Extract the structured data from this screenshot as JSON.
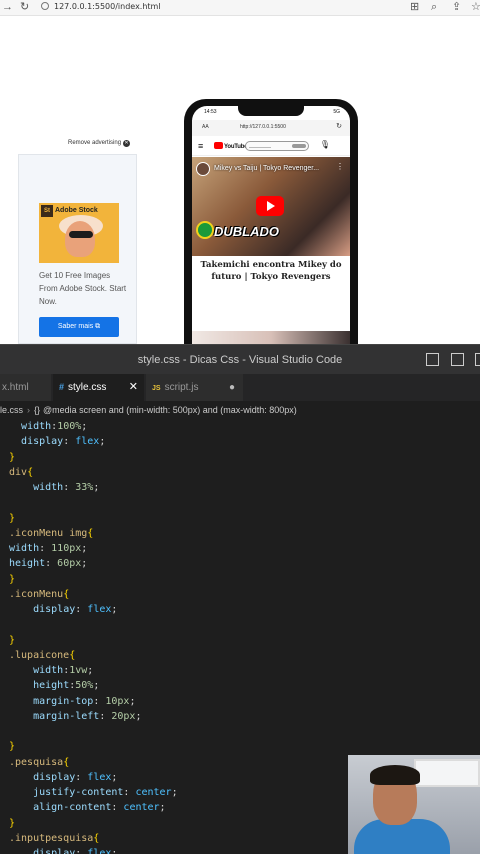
{
  "browser": {
    "url": "127.0.0.1:5500/index.html"
  },
  "page": {
    "ad": {
      "remove_label": "Remove advertising",
      "brand": "Adobe Stock",
      "brand_badge": "St",
      "text": "Get 10 Free Images From Adobe Stock. Start Now.",
      "button_label": "Saber mais"
    },
    "phone": {
      "time": "14:53",
      "status": "5G",
      "aa": "AA",
      "url": "http://127.0.0.1:5500",
      "yt_logo": "YouTube",
      "video_title": "Mikey vs Taiju | Tokyo Revenger...",
      "video_badge": "DUBLADO",
      "caption": "Takemichi encontra Mikey do futuro | Tokyo Revengers"
    }
  },
  "vscode": {
    "window_title": "style.css - Dicas Css - Visual Studio Code",
    "tabs": [
      {
        "label": "x.html"
      },
      {
        "label": "style.css",
        "icon": "#"
      },
      {
        "label": "script.js",
        "icon": "JS"
      }
    ],
    "breadcrumb": {
      "file": "le.css",
      "braces": "{}",
      "rule": "@media screen and (min-width: 500px) and (max-width: 800px)"
    },
    "code": [
      [
        {
          "t": "  ",
          "c": "pun"
        },
        {
          "t": "width",
          "c": "prop"
        },
        {
          "t": ":",
          "c": "pun"
        },
        {
          "t": "100%",
          "c": "num"
        },
        {
          "t": ";",
          "c": "pun"
        }
      ],
      [
        {
          "t": "  ",
          "c": "pun"
        },
        {
          "t": "display",
          "c": "prop"
        },
        {
          "t": ": ",
          "c": "pun"
        },
        {
          "t": "flex",
          "c": "kw"
        },
        {
          "t": ";",
          "c": "pun"
        }
      ],
      [
        {
          "t": "}",
          "c": "brace"
        }
      ],
      [
        {
          "t": "div",
          "c": "sel"
        },
        {
          "t": "{",
          "c": "brace"
        }
      ],
      [
        {
          "t": "    ",
          "c": "pun"
        },
        {
          "t": "width",
          "c": "prop"
        },
        {
          "t": ": ",
          "c": "pun"
        },
        {
          "t": "33%",
          "c": "num"
        },
        {
          "t": ";",
          "c": "pun"
        }
      ],
      [
        {
          "t": "",
          "c": "pun"
        }
      ],
      [
        {
          "t": "}",
          "c": "brace"
        }
      ],
      [
        {
          "t": ".iconMenu img",
          "c": "sel"
        },
        {
          "t": "{",
          "c": "brace"
        }
      ],
      [
        {
          "t": "width",
          "c": "prop"
        },
        {
          "t": ": ",
          "c": "pun"
        },
        {
          "t": "110px",
          "c": "num"
        },
        {
          "t": ";",
          "c": "pun"
        }
      ],
      [
        {
          "t": "height",
          "c": "prop"
        },
        {
          "t": ": ",
          "c": "pun"
        },
        {
          "t": "60px",
          "c": "num"
        },
        {
          "t": ";",
          "c": "pun"
        }
      ],
      [
        {
          "t": "}",
          "c": "brace"
        }
      ],
      [
        {
          "t": ".iconMenu",
          "c": "sel"
        },
        {
          "t": "{",
          "c": "brace"
        }
      ],
      [
        {
          "t": "    ",
          "c": "pun"
        },
        {
          "t": "display",
          "c": "prop"
        },
        {
          "t": ": ",
          "c": "pun"
        },
        {
          "t": "flex",
          "c": "kw"
        },
        {
          "t": ";",
          "c": "pun"
        }
      ],
      [
        {
          "t": "",
          "c": "pun"
        }
      ],
      [
        {
          "t": "}",
          "c": "brace"
        }
      ],
      [
        {
          "t": ".lupaicone",
          "c": "sel"
        },
        {
          "t": "{",
          "c": "brace"
        }
      ],
      [
        {
          "t": "    ",
          "c": "pun"
        },
        {
          "t": "width",
          "c": "prop"
        },
        {
          "t": ":",
          "c": "pun"
        },
        {
          "t": "1vw",
          "c": "num"
        },
        {
          "t": ";",
          "c": "pun"
        }
      ],
      [
        {
          "t": "    ",
          "c": "pun"
        },
        {
          "t": "height",
          "c": "prop"
        },
        {
          "t": ":",
          "c": "pun"
        },
        {
          "t": "50%",
          "c": "num"
        },
        {
          "t": ";",
          "c": "pun"
        }
      ],
      [
        {
          "t": "    ",
          "c": "pun"
        },
        {
          "t": "margin-top",
          "c": "prop"
        },
        {
          "t": ": ",
          "c": "pun"
        },
        {
          "t": "10px",
          "c": "num"
        },
        {
          "t": ";",
          "c": "pun"
        }
      ],
      [
        {
          "t": "    ",
          "c": "pun"
        },
        {
          "t": "margin-left",
          "c": "prop"
        },
        {
          "t": ": ",
          "c": "pun"
        },
        {
          "t": "20px",
          "c": "num"
        },
        {
          "t": ";",
          "c": "pun"
        }
      ],
      [
        {
          "t": "",
          "c": "pun"
        }
      ],
      [
        {
          "t": "}",
          "c": "brace"
        }
      ],
      [
        {
          "t": ".pesquisa",
          "c": "sel"
        },
        {
          "t": "{",
          "c": "brace"
        }
      ],
      [
        {
          "t": "    ",
          "c": "pun"
        },
        {
          "t": "display",
          "c": "prop"
        },
        {
          "t": ": ",
          "c": "pun"
        },
        {
          "t": "flex",
          "c": "kw"
        },
        {
          "t": ";",
          "c": "pun"
        }
      ],
      [
        {
          "t": "    ",
          "c": "pun"
        },
        {
          "t": "justify-content",
          "c": "prop"
        },
        {
          "t": ": ",
          "c": "pun"
        },
        {
          "t": "center",
          "c": "kw"
        },
        {
          "t": ";",
          "c": "pun"
        }
      ],
      [
        {
          "t": "    ",
          "c": "pun"
        },
        {
          "t": "align-content",
          "c": "prop"
        },
        {
          "t": ": ",
          "c": "pun"
        },
        {
          "t": "center",
          "c": "kw"
        },
        {
          "t": ";",
          "c": "pun"
        }
      ],
      [
        {
          "t": "}",
          "c": "brace"
        }
      ],
      [
        {
          "t": ".inputpesquisa",
          "c": "sel"
        },
        {
          "t": "{",
          "c": "brace"
        }
      ],
      [
        {
          "t": "    ",
          "c": "pun"
        },
        {
          "t": "display",
          "c": "prop"
        },
        {
          "t": ": ",
          "c": "pun"
        },
        {
          "t": "flex",
          "c": "kw"
        },
        {
          "t": ";",
          "c": "pun"
        }
      ]
    ]
  }
}
